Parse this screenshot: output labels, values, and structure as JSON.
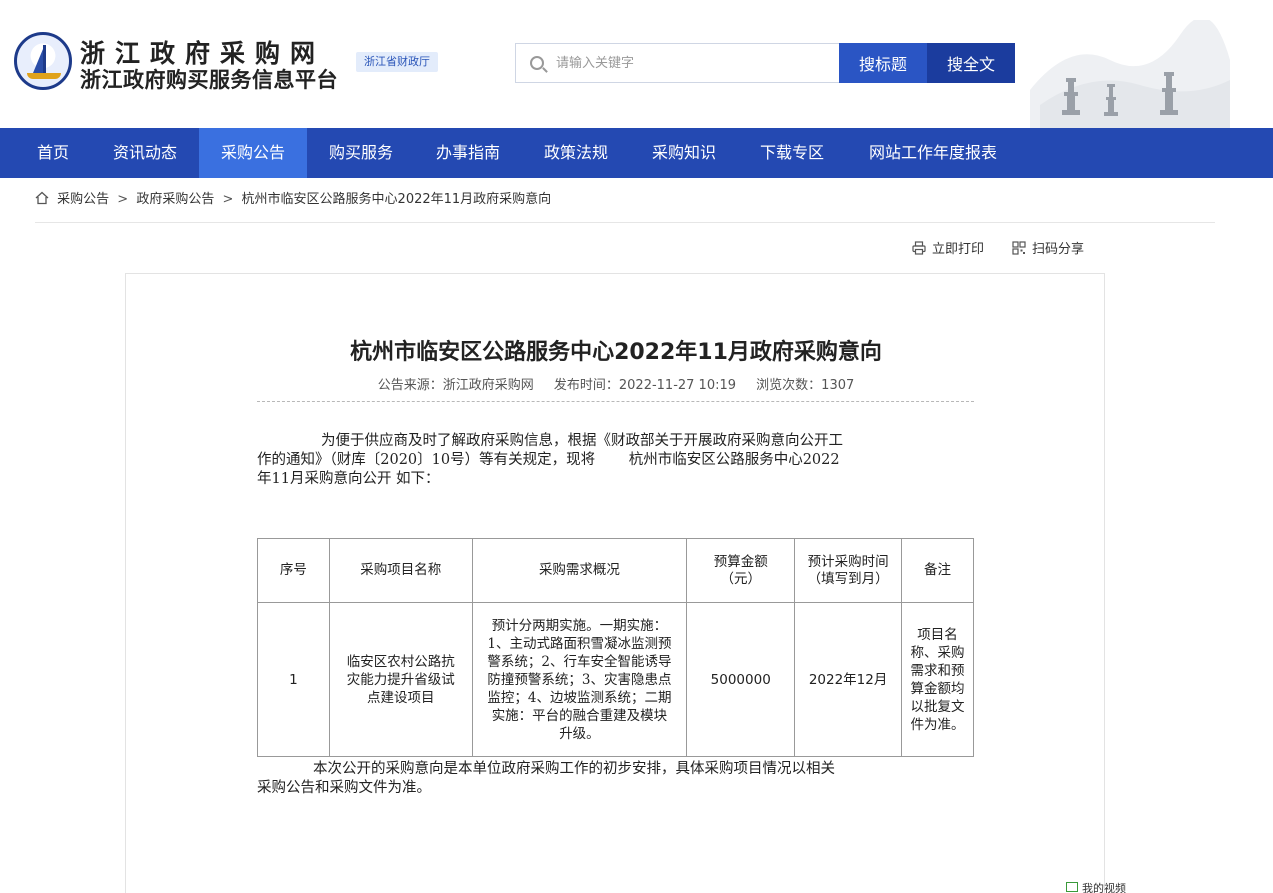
{
  "header": {
    "site_title": "浙江政府采购网",
    "site_subtitle": "浙江政府购买服务信息平台",
    "dept_badge": "浙江省财政厅",
    "search": {
      "placeholder": "请输入关键字",
      "value": ""
    },
    "btn_title": "搜标题",
    "btn_fulltext": "搜全文",
    "colors": {
      "nav_bg": "#2449b2",
      "nav_active": "#3a70e0",
      "btn_title": "#2a55c4",
      "btn_full": "#1b3c9e"
    }
  },
  "nav": {
    "items": [
      {
        "label": "首页"
      },
      {
        "label": "资讯动态"
      },
      {
        "label": "采购公告"
      },
      {
        "label": "购买服务"
      },
      {
        "label": "办事指南"
      },
      {
        "label": "政策法规"
      },
      {
        "label": "采购知识"
      },
      {
        "label": "下载专区"
      },
      {
        "label": "网站工作年度报表"
      }
    ],
    "active": "采购公告"
  },
  "breadcrumb": {
    "icon": "home-icon",
    "items": [
      "采购公告",
      "政府采购公告",
      "杭州市临安区公路服务中心2022年11月政府采购意向"
    ],
    "separator": ">"
  },
  "tools": {
    "print": "立即打印",
    "share": "扫码分享"
  },
  "article": {
    "title": "杭州市临安区公路服务中心2022年11月政府采购意向",
    "source": "公告来源：浙江政府采购网",
    "published": "发布时间：2022-11-27 10:19",
    "views": "浏览次数：1307",
    "intro_line1": "为便于供应商及时了解政府采购信息，根据《财政部关于开展政府采购意向公开工",
    "intro_line2": "作的通知》（财库〔2020〕10号）等有关规定，现将　　 杭州市临安区公路服务中心2022",
    "intro_line3": "年11月采购意向公开 如下：",
    "table": {
      "headers": [
        "序号",
        "采购项目名称",
        "采购需求概况",
        "预算金额（元）",
        "预计采购时间（填写到月）",
        "备注"
      ],
      "rows": [
        {
          "no": "1",
          "name": "临安区农村公路抗灾能力提升省级试点建设项目",
          "summary": "预计分两期实施。一期实施：1、主动式路面积雪凝冰监测预警系统；2、行车安全智能诱导防撞预警系统；3、灾害隐患点监控；4、边坡监测系统；二期实施：平台的融合重建及模块升级。",
          "budget": "5000000",
          "time": "2022年12月",
          "remark": "项目名称、采购需求和预算金额均以批复文件为准。"
        }
      ]
    },
    "closing_line1": "本次公开的采购意向是本单位政府采购工作的初步安排，具体采购项目情况以相关",
    "closing_line2": "采购公告和采购文件为准。"
  },
  "footer": {
    "video_label": "我的视频"
  }
}
